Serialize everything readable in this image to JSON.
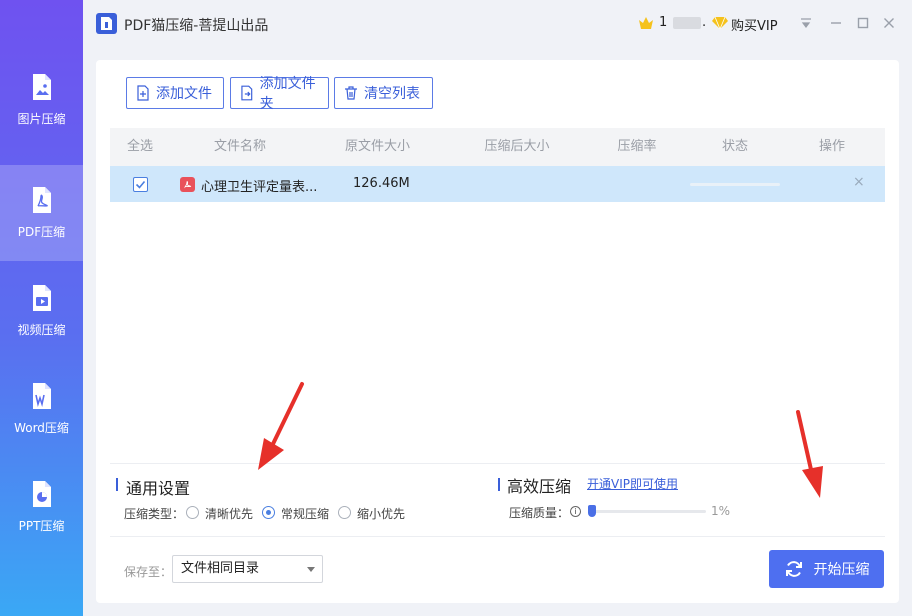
{
  "app": {
    "title": "PDF猫压缩-菩提山出品"
  },
  "titlebar": {
    "user_name_prefix": "1",
    "user_name_suffix": ".",
    "vip_label": "购买VIP",
    "window_buttons": [
      "dropdown-icon",
      "minimize-icon",
      "maximize-icon",
      "close-icon"
    ]
  },
  "sidebar": {
    "items": [
      {
        "label": "图片压缩",
        "icon": "image-file-icon",
        "active": false
      },
      {
        "label": "PDF压缩",
        "icon": "pdf-file-icon",
        "active": true
      },
      {
        "label": "视频压缩",
        "icon": "video-file-icon",
        "active": false
      },
      {
        "label": "Word压缩",
        "icon": "word-file-icon",
        "active": false
      },
      {
        "label": "PPT压缩",
        "icon": "ppt-file-icon",
        "active": false
      }
    ]
  },
  "toolbar": {
    "add_file": "添加文件",
    "add_folder": "添加文件夹",
    "clear_list": "清空列表"
  },
  "table": {
    "headers": [
      "全选",
      "文件名称",
      "原文件大小",
      "压缩后大小",
      "压缩率",
      "状态",
      "操作"
    ],
    "rows": [
      {
        "checked": true,
        "name": "心理卫生评定量表...",
        "original_size": "126.46M",
        "compressed_size": "",
        "ratio": "",
        "status_progress": 0,
        "action": "×"
      }
    ]
  },
  "settings": {
    "general_title": "通用设置",
    "type_label": "压缩类型：",
    "options": [
      "清晰优先",
      "常规压缩",
      "缩小优先"
    ],
    "selected_option": "常规压缩",
    "efficient_title": "高效压缩",
    "vip_link": "开通VIP即可使用",
    "quality_label": "压缩质量：",
    "quality_value_text": "1%",
    "quality_value": 1
  },
  "footer": {
    "save_label": "保存至：",
    "save_value": "文件相同目录",
    "start_label": "开始压缩"
  },
  "colors": {
    "accent": "#4e6ff0",
    "selected_row": "#cfe7fb",
    "annotation_red": "#e6302a"
  }
}
